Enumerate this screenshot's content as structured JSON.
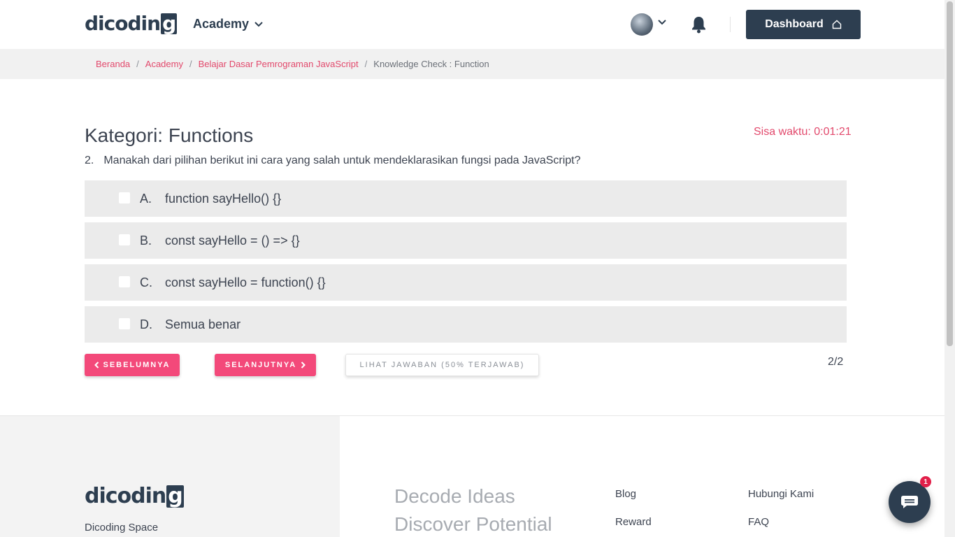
{
  "header": {
    "logo_main": "dicodin",
    "logo_g": "g",
    "academy_label": "Academy",
    "dashboard_label": "Dashboard"
  },
  "breadcrumb": {
    "items": [
      "Beranda",
      "Academy",
      "Belajar Dasar Pemrograman JavaScript"
    ],
    "current": "Knowledge Check : Function",
    "separator": "/"
  },
  "quiz": {
    "title": "Kategori: Functions",
    "timer": "Sisa waktu: 0:01:21",
    "question_number": "2.",
    "question": "Manakah dari pilihan berikut ini cara yang salah untuk mendeklarasikan fungsi pada JavaScript?",
    "options": [
      {
        "letter": "A.",
        "text": "function sayHello() {}",
        "checked": false
      },
      {
        "letter": "B.",
        "text": "const sayHello = () => {}",
        "checked": false
      },
      {
        "letter": "C.",
        "text": "const sayHello = function() {}",
        "checked": false
      },
      {
        "letter": "D.",
        "text": "Semua benar",
        "checked": false
      }
    ],
    "prev_label": "SEBELUMNYA",
    "next_label": "SELANJUTNYA",
    "answers_label": "LIHAT JAWABAN (50% TERJAWAB)",
    "pager": "2/2"
  },
  "footer": {
    "logo_main": "dicodin",
    "logo_g": "g",
    "space_label": "Dicoding Space",
    "tagline_1": "Decode Ideas",
    "tagline_2": "Discover Potential",
    "links_col1": [
      "Blog",
      "Reward"
    ],
    "links_col2": [
      "Hubungi Kami",
      "FAQ"
    ]
  },
  "chat": {
    "badge_count": "1"
  },
  "colors": {
    "brand_dark": "#2d3e50",
    "accent_pink": "#f3497a",
    "link_pink": "#e2496c"
  }
}
